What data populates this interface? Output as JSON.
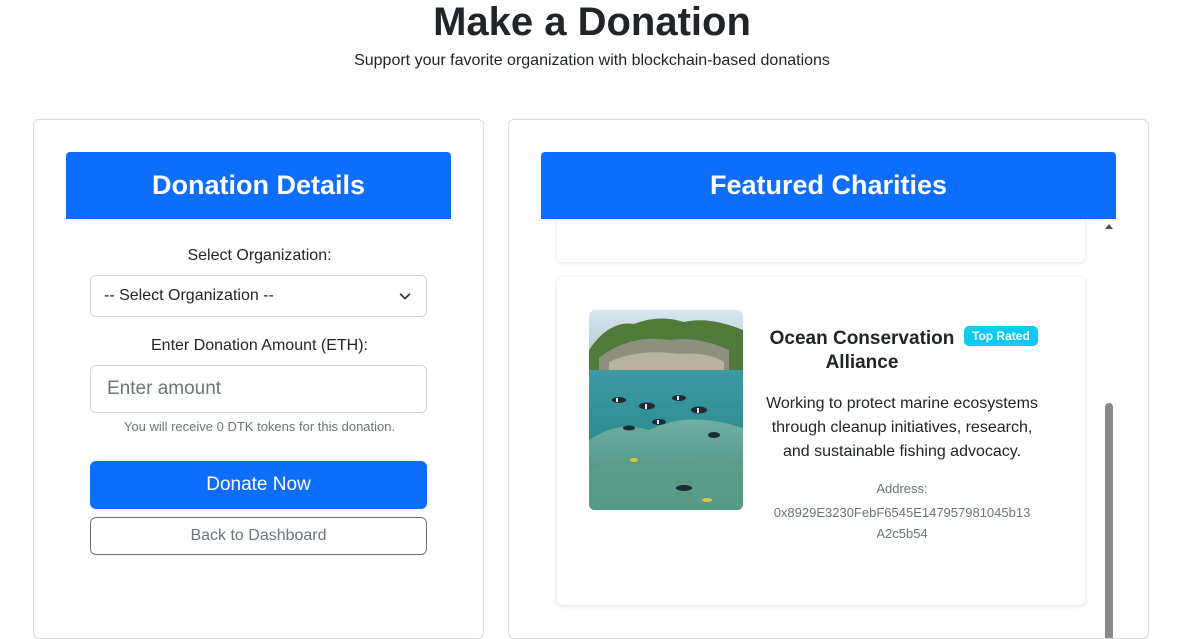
{
  "header": {
    "title": "Make a Donation",
    "subtitle": "Support your favorite organization with blockchain-based donations"
  },
  "donation_form": {
    "heading": "Donation Details",
    "org_label": "Select Organization:",
    "org_selected": "-- Select Organization --",
    "amount_label": "Enter Donation Amount (ETH):",
    "amount_placeholder": "Enter amount",
    "amount_value": "",
    "token_note": "You will receive 0 DTK tokens for this donation.",
    "donate_label": "Donate Now",
    "back_label": "Back to Dashboard"
  },
  "featured": {
    "heading": "Featured Charities",
    "charities": [
      {
        "name": "Ocean Conservation Alliance",
        "badge": "Top Rated",
        "description": "Working to protect marine ecosystems through cleanup initiatives, research, and sustainable fishing advocacy.",
        "address_label": "Address:",
        "address": "0x8929E3230FebF6545E147957981045b13A2c5b54"
      }
    ]
  },
  "colors": {
    "primary": "#0d6efd",
    "badge": "#0dcaf0",
    "muted": "#6c757d"
  },
  "icons": {
    "select_chevron": "chevron-down-icon",
    "scroll_up": "scroll-up-arrow-icon"
  }
}
